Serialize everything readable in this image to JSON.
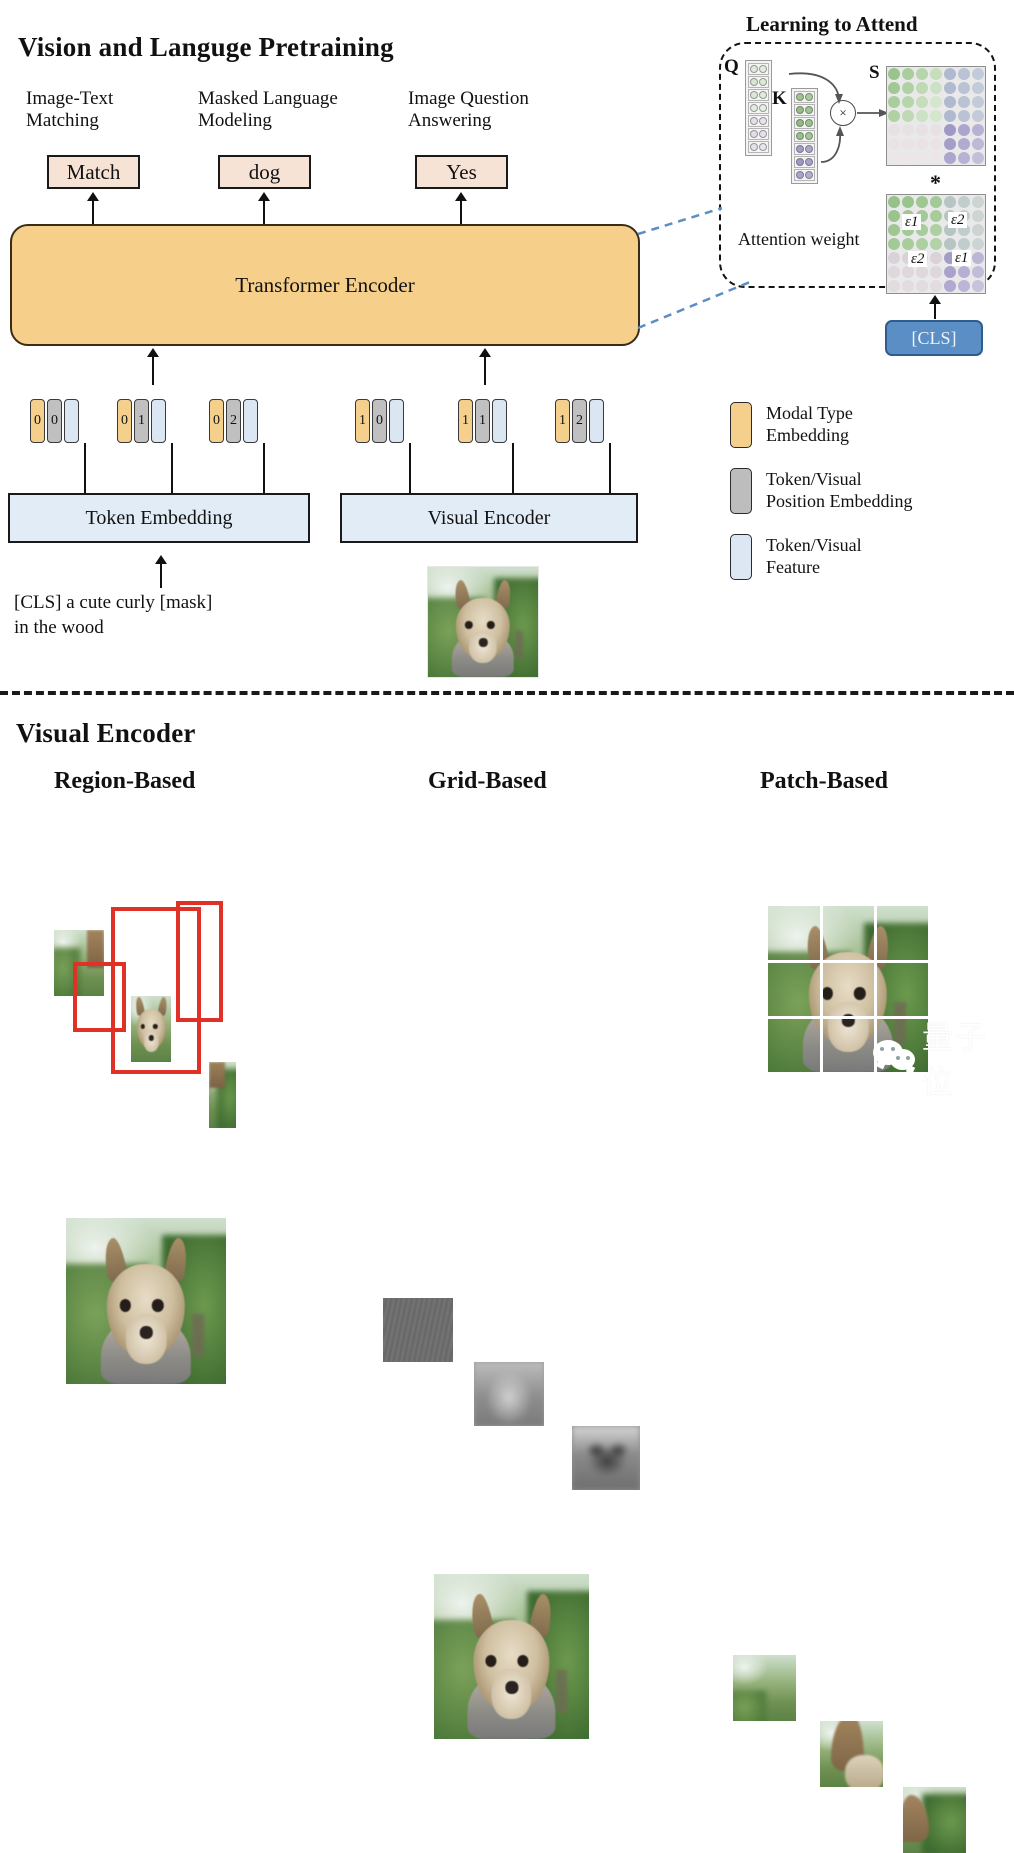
{
  "top_section": {
    "title": "Vision and Languge Pretraining",
    "tasks": [
      {
        "label": "Image-Text\nMatching",
        "output": "Match"
      },
      {
        "label": "Masked Language\nModeling",
        "output": "dog"
      },
      {
        "label": "Image Question\nAnswering",
        "output": "Yes"
      }
    ],
    "encoder_label": "Transformer Encoder",
    "text_encoder_label": "Token Embedding",
    "visual_encoder_label": "Visual Encoder",
    "input_sentence": "[CLS] a cute curly [mask]\nin the wood",
    "token_groups": {
      "text": [
        {
          "modal": "0",
          "position": "0"
        },
        {
          "modal": "0",
          "position": "1"
        },
        {
          "modal": "0",
          "position": "2"
        }
      ],
      "visual": [
        {
          "modal": "1",
          "position": "0"
        },
        {
          "modal": "1",
          "position": "1"
        },
        {
          "modal": "1",
          "position": "2"
        }
      ]
    }
  },
  "legend": {
    "items": [
      {
        "label": "Modal Type\nEmbedding",
        "color": "#f5d08d",
        "swatch": "modal"
      },
      {
        "label": "Token/Visual\nPosition Embedding",
        "color": "#bdbdbd",
        "swatch": "pos"
      },
      {
        "label": "Token/Visual\nFeature",
        "color": "#dde7f4",
        "swatch": "feat"
      }
    ]
  },
  "inset": {
    "title": "Learning to Attend",
    "q_label": "Q",
    "k_label": "K",
    "s_label": "S",
    "mul_symbol": "×",
    "star_symbol": "*",
    "attention_weight_label": "Attention weight",
    "epsilon_labels": [
      "ε1",
      "ε2",
      "ε2",
      "ε1"
    ],
    "cls_label": "[CLS]"
  },
  "bottom_section": {
    "title": "Visual Encoder",
    "columns": [
      {
        "heading": "Region-Based"
      },
      {
        "heading": "Grid-Based"
      },
      {
        "heading": "Patch-Based"
      }
    ]
  },
  "watermark": {
    "text": "量子位"
  },
  "colors": {
    "encoder_fill": "#f6cf8a",
    "output_box_fill": "#f7e3d6",
    "sub_encoder_fill": "#e2ecf7",
    "cls_fill": "#5b8ec4",
    "region_box_stroke": "#e03127",
    "modal_type": "#f5d08d",
    "position_embedding": "#bdbdbd",
    "feature": "#dde7f4"
  }
}
